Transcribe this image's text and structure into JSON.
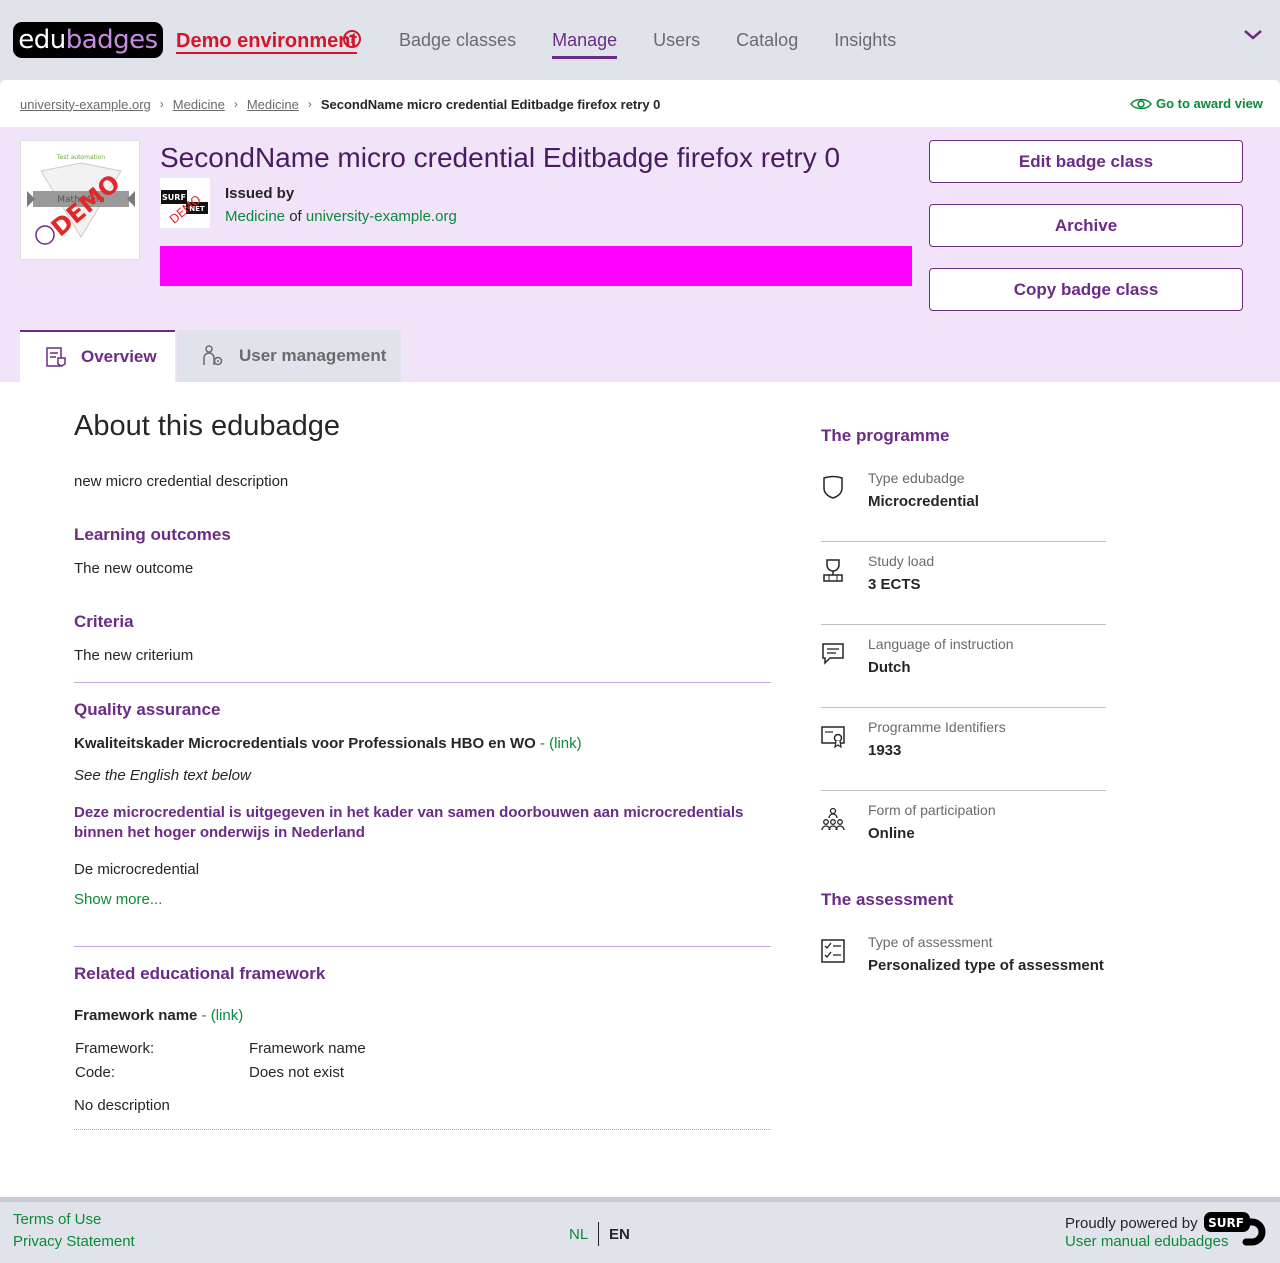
{
  "header": {
    "logo_edu": "edu",
    "logo_badges": "badges",
    "demo_label": "Demo environment",
    "demo_help": "?",
    "nav": [
      "Badge classes",
      "Manage",
      "Users",
      "Catalog",
      "Insights"
    ],
    "active_nav": "Manage"
  },
  "breadcrumb": {
    "items": [
      "university-example.org",
      "Medicine",
      "Medicine"
    ],
    "current": "SecondName micro credential Editbadge firefox retry 0",
    "award_view": "Go to award view"
  },
  "badge": {
    "title": "SecondName micro credential Editbadge firefox retry 0",
    "issued_by_label": "Issued by",
    "issuer_faculty": "Medicine",
    "of": "of",
    "issuer_institution": "university-example.org",
    "image_caption": "Test automation",
    "image_ribbon": "Math Mem",
    "image_stamp": "DEMO",
    "issuer_logo_top": "SURF",
    "issuer_logo_bottom": "NET",
    "issuer_logo_stamp": "DEMO",
    "highlight_color": "#ff00ff"
  },
  "actions": {
    "edit": "Edit badge class",
    "archive": "Archive",
    "copy": "Copy badge class"
  },
  "tabs": {
    "overview": "Overview",
    "users": "User management"
  },
  "about": {
    "title": "About this edubadge",
    "description": "new micro credential description",
    "learning_title": "Learning outcomes",
    "learning_text": "The new outcome",
    "criteria_title": "Criteria",
    "criteria_text": "The new criterium",
    "qa_title": "Quality assurance",
    "qa_name": "Kwaliteitskader Microcredentials voor Professionals HBO en WO",
    "qa_link": " - (link)",
    "qa_english": "See the English text below",
    "qa_paragraph": "Deze microcredential is uitgegeven in het kader van samen doorbouwen aan microcredentials binnen het hoger onderwijs in Nederland",
    "qa_body": "De microcredential",
    "show_more": "Show more...",
    "framework_title": "Related educational framework",
    "framework_name": "Framework name",
    "framework_link": " - (link)",
    "framework_label": "Framework:",
    "framework_value": "Framework name",
    "code_label": "Code:",
    "code_value": "Does not exist",
    "framework_desc": "No description"
  },
  "programme": {
    "title": "The programme",
    "items": [
      {
        "label": "Type edubadge",
        "value": "Microcredential",
        "icon": "shield-icon"
      },
      {
        "label": "Study load",
        "value": "3 ECTS",
        "icon": "trophy-icon"
      },
      {
        "label": "Language of instruction",
        "value": "Dutch",
        "icon": "chat-icon"
      },
      {
        "label": "Programme Identifiers",
        "value": "1933",
        "icon": "certificate-icon"
      },
      {
        "label": "Form of participation",
        "value": "Online",
        "icon": "people-icon"
      }
    ],
    "assessment_title": "The assessment",
    "assessment": {
      "label": "Type of assessment",
      "value": "Personalized type of assessment",
      "icon": "checklist-icon"
    }
  },
  "footer": {
    "terms": "Terms of Use",
    "privacy": "Privacy Statement",
    "lang_nl": "NL",
    "lang_en": "EN",
    "powered": "Proudly powered by",
    "surf": "SURF",
    "manual": "User manual edubadges"
  },
  "colors": {
    "accent": "#6b2b86",
    "link": "#0a8a3a",
    "demo": "#d4152c"
  }
}
